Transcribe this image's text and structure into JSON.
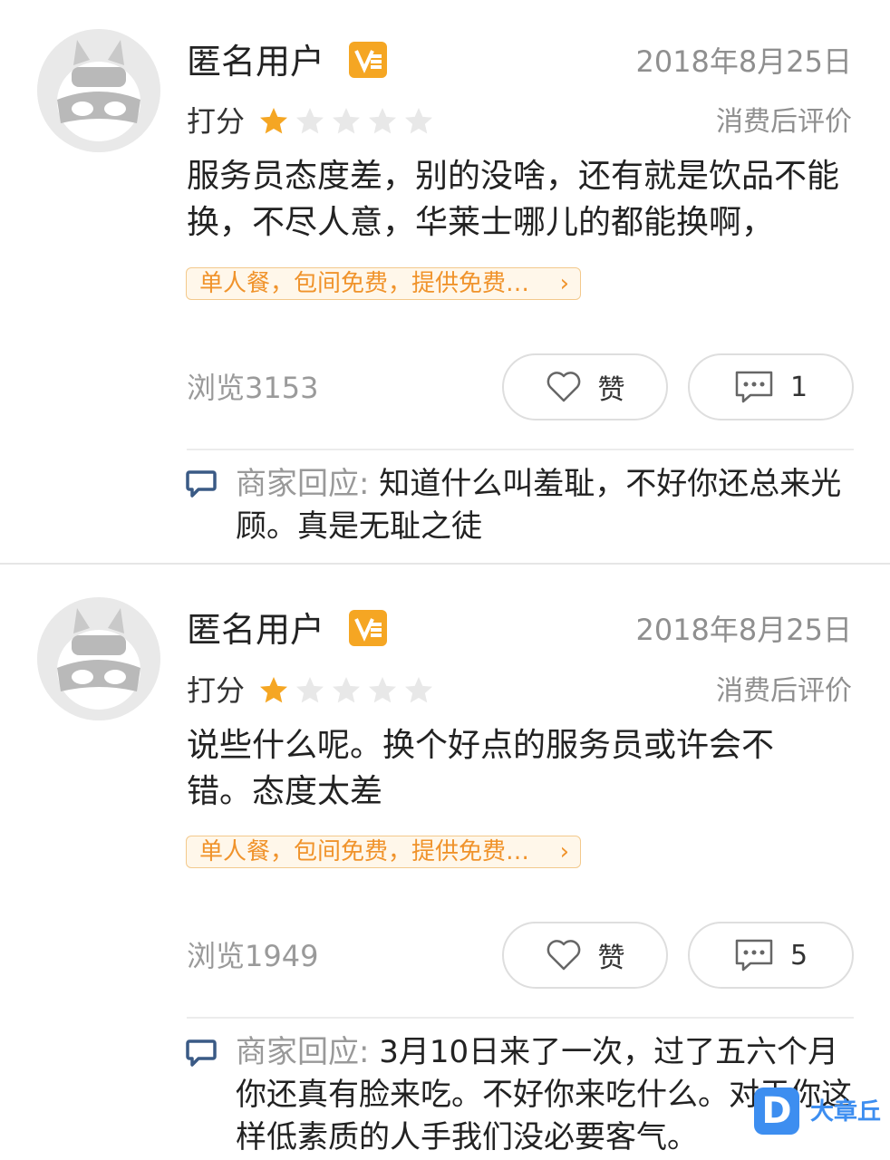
{
  "reviews": [
    {
      "username": "匿名用户",
      "vip_badge_icon": "vip-level-icon",
      "date": "2018年8月25日",
      "score_label": "打分",
      "rating": 1,
      "rating_max": 5,
      "eval_tag": "消费后评价",
      "content": "服务员态度差，别的没啥，还有就是饮品不能换，不尽人意，华莱士哪儿的都能换啊，",
      "tag": "单人餐，包间免费，提供免费…",
      "views": "浏览3153",
      "like_label": "赞",
      "comment_count": "1",
      "reply_label": "商家回应:",
      "reply_text": "知道什么叫羞耻，不好你还总来光顾。真是无耻之徒"
    },
    {
      "username": "匿名用户",
      "vip_badge_icon": "vip-level-icon",
      "date": "2018年8月25日",
      "score_label": "打分",
      "rating": 1,
      "rating_max": 5,
      "eval_tag": "消费后评价",
      "content": "说些什么呢。换个好点的服务员或许会不错。态度太差",
      "tag": "单人餐，包间免费，提供免费…",
      "views": "浏览1949",
      "like_label": "赞",
      "comment_count": "5",
      "reply_label": "商家回应:",
      "reply_text": "3月10日来了一次，过了五六个月你还真有脸来吃。不好你来吃什么。对于你这样低素质的人手我们没必要客气。"
    }
  ],
  "watermark": {
    "logo": "D",
    "text": "大章丘"
  },
  "colors": {
    "star_active": "#f5a623",
    "star_inactive": "#e8e8e8",
    "tag_text": "#f0932b",
    "tag_bg": "#fff7ea",
    "reply_icon": "#3a5a85",
    "watermark": "#3d8ef0"
  }
}
